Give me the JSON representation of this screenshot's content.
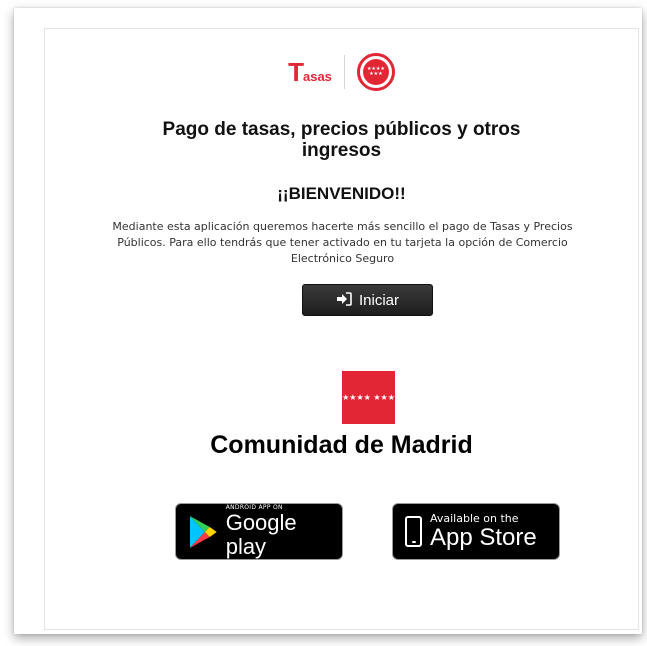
{
  "header": {
    "tasas_logo_initial": "T",
    "tasas_logo_rest": "asas",
    "seal_stars": "★★★★ ★★★"
  },
  "main": {
    "title": "Pago de tasas, precios públicos y otros ingresos",
    "welcome": "¡¡BIENVENIDO!!",
    "description": "Mediante esta aplicación queremos hacerte más sencillo el pago de Tasas y Precios Públicos. Para ello tendrás que tener activado en tu tarjeta la opción de Comercio Electrónico Seguro",
    "start_button_label": "Iniciar",
    "start_button_icon": "sign-in-icon"
  },
  "footer": {
    "flag_stars": "★★★★ ★★★",
    "organization": "Comunidad de Madrid",
    "google_play": {
      "top": "ANDROID APP ON",
      "bottom": "Google play"
    },
    "app_store": {
      "top": "Available on the",
      "bottom": "App Store"
    }
  },
  "colors": {
    "brand_red": "#e32636",
    "button_dark": "#2a2a2a",
    "badge_black": "#000000"
  }
}
